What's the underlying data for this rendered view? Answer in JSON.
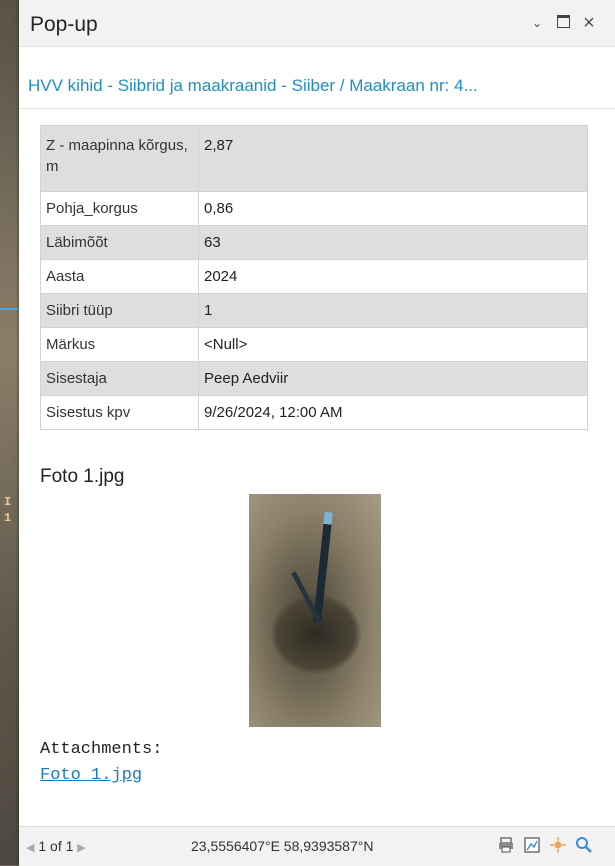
{
  "window": {
    "title": "Pop-up"
  },
  "layer": {
    "title": "HVV kihid - Siibrid ja maakraanid - Siiber / Maakraan nr: 4..."
  },
  "attributes": [
    {
      "field": "Z - maapinna kõrgus, m",
      "value": "2,87"
    },
    {
      "field": "Pohja_korgus",
      "value": "0,86"
    },
    {
      "field": "Läbimõõt",
      "value": "63"
    },
    {
      "field": "Aasta",
      "value": "2024"
    },
    {
      "field": "Siibri tüüp",
      "value": "1"
    },
    {
      "field": "Märkus",
      "value": "<Null>"
    },
    {
      "field": "Sisestaja",
      "value": "Peep Aedviir"
    },
    {
      "field": "Sisestus kpv",
      "value": "9/26/2024, 12:00 AM"
    }
  ],
  "photo": {
    "title": "Foto 1.jpg"
  },
  "attachments": {
    "label": "Attachments:",
    "link": "Foto 1.jpg"
  },
  "footer": {
    "pager": "1 of 1",
    "coordinates": "23,5556407°E 58,9393587°N"
  },
  "map": {
    "label_line1": "I",
    "label_line2": "1"
  },
  "icons": [
    "chevron-down-icon",
    "maximize-icon",
    "close-icon",
    "prev-icon",
    "next-icon",
    "print-icon",
    "map-extent-icon",
    "flash-icon",
    "zoom-to-icon"
  ],
  "colors": {
    "link": "#1f8fc1",
    "row_shade": "#dedede",
    "titlebar": "#f2f2f2"
  }
}
